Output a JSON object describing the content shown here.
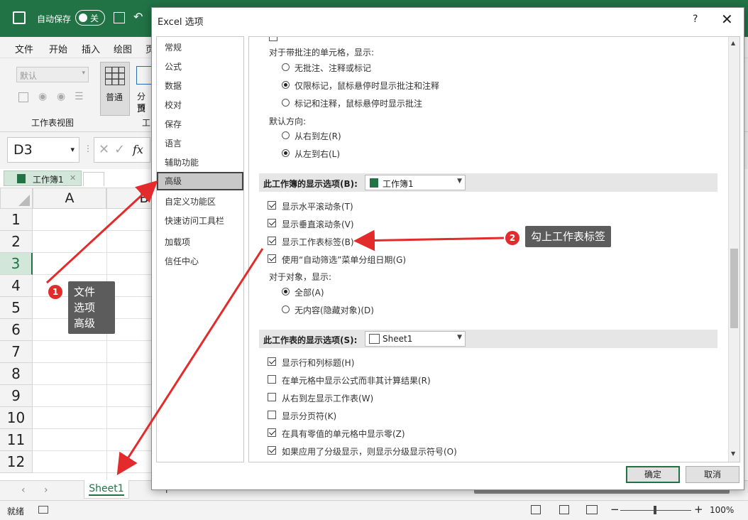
{
  "excel": {
    "autosave_label": "自动保存",
    "autosave_state": "关",
    "menu": [
      "文件",
      "开始",
      "插入",
      "绘图",
      "页"
    ],
    "ribbon": {
      "view_dropdown": "默认",
      "group_label": "工作表视图",
      "normal_label": "普通",
      "pagebreak_label_1": "分页",
      "pagebreak_label_2": "预览",
      "group2_label": "工"
    },
    "name_box": "D3",
    "fx": "fx",
    "workbook_tab": "工作簿1",
    "column_a": "A",
    "column_b": "B",
    "rows": [
      "1",
      "2",
      "3",
      "4",
      "5",
      "6",
      "7",
      "8",
      "9",
      "10",
      "11",
      "12"
    ],
    "sheet_tab": "Sheet1",
    "status_ready": "就绪",
    "zoom": "100%"
  },
  "dialog": {
    "title": "Excel 选项",
    "help": "?",
    "close": "✕",
    "nav": [
      "常规",
      "公式",
      "数据",
      "校对",
      "保存",
      "语言",
      "辅助功能",
      "高级",
      "自定义功能区",
      "快速访问工具栏",
      "加载项",
      "信任中心"
    ],
    "nav_active": "高级",
    "comments_heading": "对于带批注的单元格，显示:",
    "comments_options": [
      "无批注、注释或标记",
      "仅限标记，鼠标悬停时显示批注和注释",
      "标记和注释，鼠标悬停时显示批注"
    ],
    "direction_heading": "默认方向:",
    "direction_options": [
      "从右到左(R)",
      "从左到右(L)"
    ],
    "workbook_section": "此工作簿的显示选项(B):",
    "workbook_combo": "工作簿1",
    "workbook_options": [
      "显示水平滚动条(T)",
      "显示垂直滚动条(V)",
      "显示工作表标签(B)",
      "使用“自动筛选”菜单分组日期(G)"
    ],
    "objects_heading": "对于对象，显示:",
    "objects_options": [
      "全部(A)",
      "无内容(隐藏对象)(D)"
    ],
    "worksheet_section": "此工作表的显示选项(S):",
    "worksheet_combo": "Sheet1",
    "worksheet_options": [
      "显示行和列标题(H)",
      "在单元格中显示公式而非其计算结果(R)",
      "从右到左显示工作表(W)",
      "显示分页符(K)",
      "在具有零值的单元格中显示零(Z)",
      "如果应用了分级显示，则显示分级显示符号(O)"
    ],
    "ok": "确定",
    "cancel": "取消"
  },
  "annotations": {
    "badge1": "1",
    "callout1": [
      "文件",
      "选项",
      "高级"
    ],
    "badge2": "2",
    "callout2": "勾上工作表标签"
  },
  "colors": {
    "excel_green": "#217346",
    "arrow_red": "#e32b2b"
  }
}
